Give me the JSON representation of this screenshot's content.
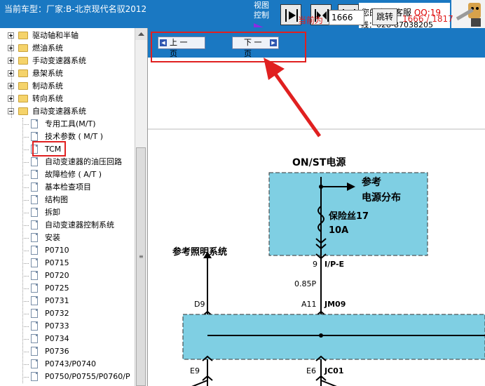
{
  "header": {
    "vehicle_label": "当前车型：厂家:B-北京现代名驭2012",
    "view_control_label": "视图控制",
    "service_text": "您的专职客服",
    "service_qq": "QQ:19",
    "service_phone": "线：028-87038205"
  },
  "sidebar": {
    "folders": [
      {
        "label": "驱动轴和半轴",
        "expanded": false
      },
      {
        "label": "燃油系统",
        "expanded": false
      },
      {
        "label": "手动变速器系统",
        "expanded": false
      },
      {
        "label": "悬架系统",
        "expanded": false
      },
      {
        "label": "制动系统",
        "expanded": false
      },
      {
        "label": "转向系统",
        "expanded": false
      },
      {
        "label": "自动变速器系统",
        "expanded": true
      }
    ],
    "children": [
      "专用工具(M/T)",
      "技术参数 ( M/T )",
      "TCM",
      "自动变速器的油压回路",
      "故障检修 ( A/T )",
      "基本检查项目",
      "结构图",
      "拆卸",
      "自动变速器控制系统",
      "安装",
      "P0710",
      "P0715",
      "P0720",
      "P0725",
      "P0731",
      "P0732",
      "P0733",
      "P0734",
      "P0736",
      "P0743/P0740",
      "P0750/P0755/P0760/P"
    ]
  },
  "toolbar": {
    "prev_label": "上 一 页",
    "next_label": "下 一 页",
    "current_label": "当前为",
    "page_value": "1666",
    "jump_label": "跳转",
    "page_count": "1666 / 1817"
  },
  "diagram": {
    "power_title": "ON/ST电源",
    "ref_label_1": "参考",
    "ref_label_2": "电源分布",
    "fuse_label": "保险丝17",
    "fuse_rating": "10A",
    "lighting_ref": "参考照明系统",
    "pin_9": "9",
    "conn_ipe": "I/P-E",
    "wire_085p": "0.85P",
    "pin_d9": "D9",
    "pin_a11": "A11",
    "conn_jm09": "JM09",
    "pin_e9": "E9",
    "pin_e6": "E6",
    "conn_jc01": "JC01"
  },
  "colors": {
    "header_blue": "#1a78c2",
    "highlight_red": "#e02020",
    "diagram_box": "#7fcfe3"
  }
}
